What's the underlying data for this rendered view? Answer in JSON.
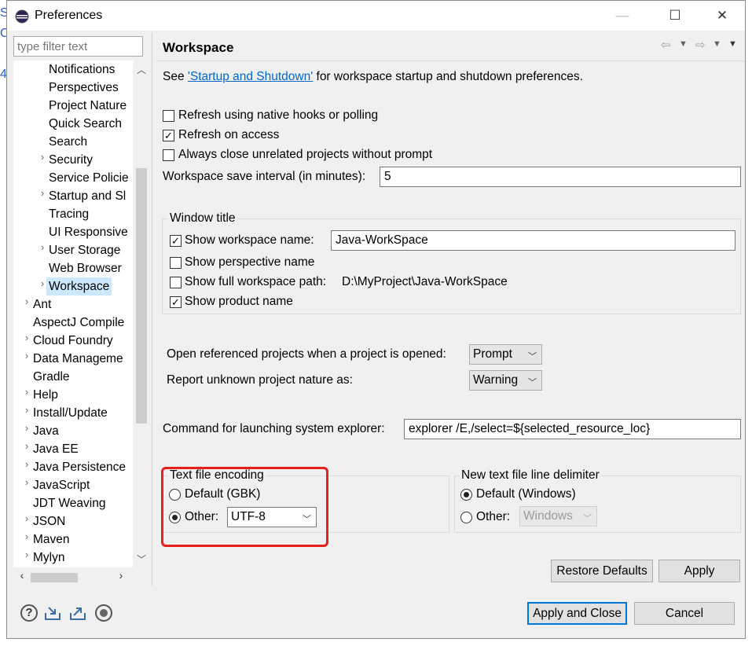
{
  "window": {
    "title": "Preferences",
    "min_glyph": "—",
    "max_glyph": "☐",
    "close_glyph": "✕"
  },
  "filter": {
    "placeholder": "type filter text"
  },
  "tree": {
    "items": [
      {
        "label": "Notifications",
        "level": 1,
        "expandable": false
      },
      {
        "label": "Perspectives",
        "level": 1,
        "expandable": false
      },
      {
        "label": "Project Nature",
        "level": 1,
        "expandable": false
      },
      {
        "label": "Quick Search",
        "level": 1,
        "expandable": false
      },
      {
        "label": "Search",
        "level": 1,
        "expandable": false
      },
      {
        "label": "Security",
        "level": 1,
        "expandable": true
      },
      {
        "label": "Service Policie",
        "level": 1,
        "expandable": false
      },
      {
        "label": "Startup and Sl",
        "level": 1,
        "expandable": true
      },
      {
        "label": "Tracing",
        "level": 1,
        "expandable": false
      },
      {
        "label": "UI Responsive",
        "level": 1,
        "expandable": false
      },
      {
        "label": "User Storage",
        "level": 1,
        "expandable": true
      },
      {
        "label": "Web Browser",
        "level": 1,
        "expandable": false
      },
      {
        "label": "Workspace",
        "level": 1,
        "expandable": true,
        "selected": true
      },
      {
        "label": "Ant",
        "level": 0,
        "expandable": true
      },
      {
        "label": "AspectJ Compile",
        "level": 0,
        "expandable": false
      },
      {
        "label": "Cloud Foundry",
        "level": 0,
        "expandable": true
      },
      {
        "label": "Data Manageme",
        "level": 0,
        "expandable": true
      },
      {
        "label": "Gradle",
        "level": 0,
        "expandable": false
      },
      {
        "label": "Help",
        "level": 0,
        "expandable": true
      },
      {
        "label": "Install/Update",
        "level": 0,
        "expandable": true
      },
      {
        "label": "Java",
        "level": 0,
        "expandable": true
      },
      {
        "label": "Java EE",
        "level": 0,
        "expandable": true
      },
      {
        "label": "Java Persistence",
        "level": 0,
        "expandable": true
      },
      {
        "label": "JavaScript",
        "level": 0,
        "expandable": true
      },
      {
        "label": "JDT Weaving",
        "level": 0,
        "expandable": false
      },
      {
        "label": "JSON",
        "level": 0,
        "expandable": true
      },
      {
        "label": "Maven",
        "level": 0,
        "expandable": true
      },
      {
        "label": "Mylyn",
        "level": 0,
        "expandable": true
      }
    ]
  },
  "page": {
    "title": "Workspace",
    "intro": {
      "prefix": "See ",
      "link": "'Startup and Shutdown'",
      "suffix": " for workspace startup and shutdown preferences."
    },
    "options": {
      "refresh_native": {
        "label": "Refresh using native hooks or polling",
        "checked": false
      },
      "refresh_access": {
        "label": "Refresh on access",
        "checked": true
      },
      "always_close": {
        "label": "Always close unrelated projects without prompt",
        "checked": false
      }
    },
    "save_interval": {
      "label": "Workspace save interval (in minutes):",
      "value": "5"
    },
    "window_title": {
      "group_label": "Window title",
      "show_workspace_name": {
        "label": "Show workspace name:",
        "checked": true,
        "value": "Java-WorkSpace"
      },
      "show_perspective_name": {
        "label": "Show perspective name",
        "checked": false
      },
      "show_full_path": {
        "label": "Show full workspace path:",
        "checked": false,
        "value": "D:\\MyProject\\Java-WorkSpace"
      },
      "show_product_name": {
        "label": "Show product name",
        "checked": true
      }
    },
    "open_referenced": {
      "label": "Open referenced projects when a project is opened:",
      "value": "Prompt"
    },
    "unknown_nature": {
      "label": "Report unknown project nature as:",
      "value": "Warning"
    },
    "explorer_cmd": {
      "label": "Command for launching system explorer:",
      "value": "explorer /E,/select=${selected_resource_loc}"
    },
    "encoding": {
      "group_label": "Text file encoding",
      "default_label": "Default (GBK)",
      "other_label": "Other:",
      "other_value": "UTF-8",
      "selected": "other"
    },
    "line_delim": {
      "group_label": "New text file line delimiter",
      "default_label": "Default (Windows)",
      "other_label": "Other:",
      "other_value": "Windows",
      "selected": "default"
    },
    "buttons": {
      "restore": "Restore Defaults",
      "apply": "Apply"
    }
  },
  "footer": {
    "apply_close": "Apply and Close",
    "cancel": "Cancel"
  },
  "icons": [
    "help-icon",
    "import-icon",
    "export-icon",
    "record-icon"
  ],
  "colors": {
    "link": "#0066cc",
    "highlight": "#e8201c",
    "selection": "#cce8ff",
    "default_button_border": "#0078d7"
  }
}
